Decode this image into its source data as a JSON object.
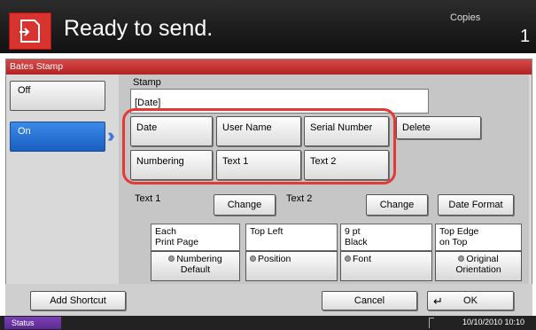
{
  "header": {
    "title": "Ready to send.",
    "copies_label": "Copies",
    "copies_value": "1"
  },
  "panel": {
    "title": "Bates Stamp"
  },
  "modes": {
    "off": "Off",
    "on": "On"
  },
  "stamp": {
    "label": "Stamp",
    "value": "[Date]",
    "buttons": [
      "Date",
      "User Name",
      "Serial Number",
      "Numbering",
      "Text 1",
      "Text 2"
    ],
    "delete": "Delete"
  },
  "text_row": {
    "text1": "Text 1",
    "text2": "Text 2",
    "change": "Change",
    "date_format": "Date Format"
  },
  "settings": [
    {
      "value": "Each\nPrint Page",
      "button": "Numbering\nDefault"
    },
    {
      "value": "Top Left",
      "button": "Position"
    },
    {
      "value": "9 pt\nBlack",
      "button": "Font"
    },
    {
      "value": "Top Edge\non Top",
      "button": "Original\nOrientation"
    }
  ],
  "footer": {
    "add_shortcut": "Add Shortcut",
    "cancel": "Cancel",
    "ok": "OK"
  },
  "status": {
    "label": "Status",
    "datetime": "10/10/2010  10:10"
  }
}
